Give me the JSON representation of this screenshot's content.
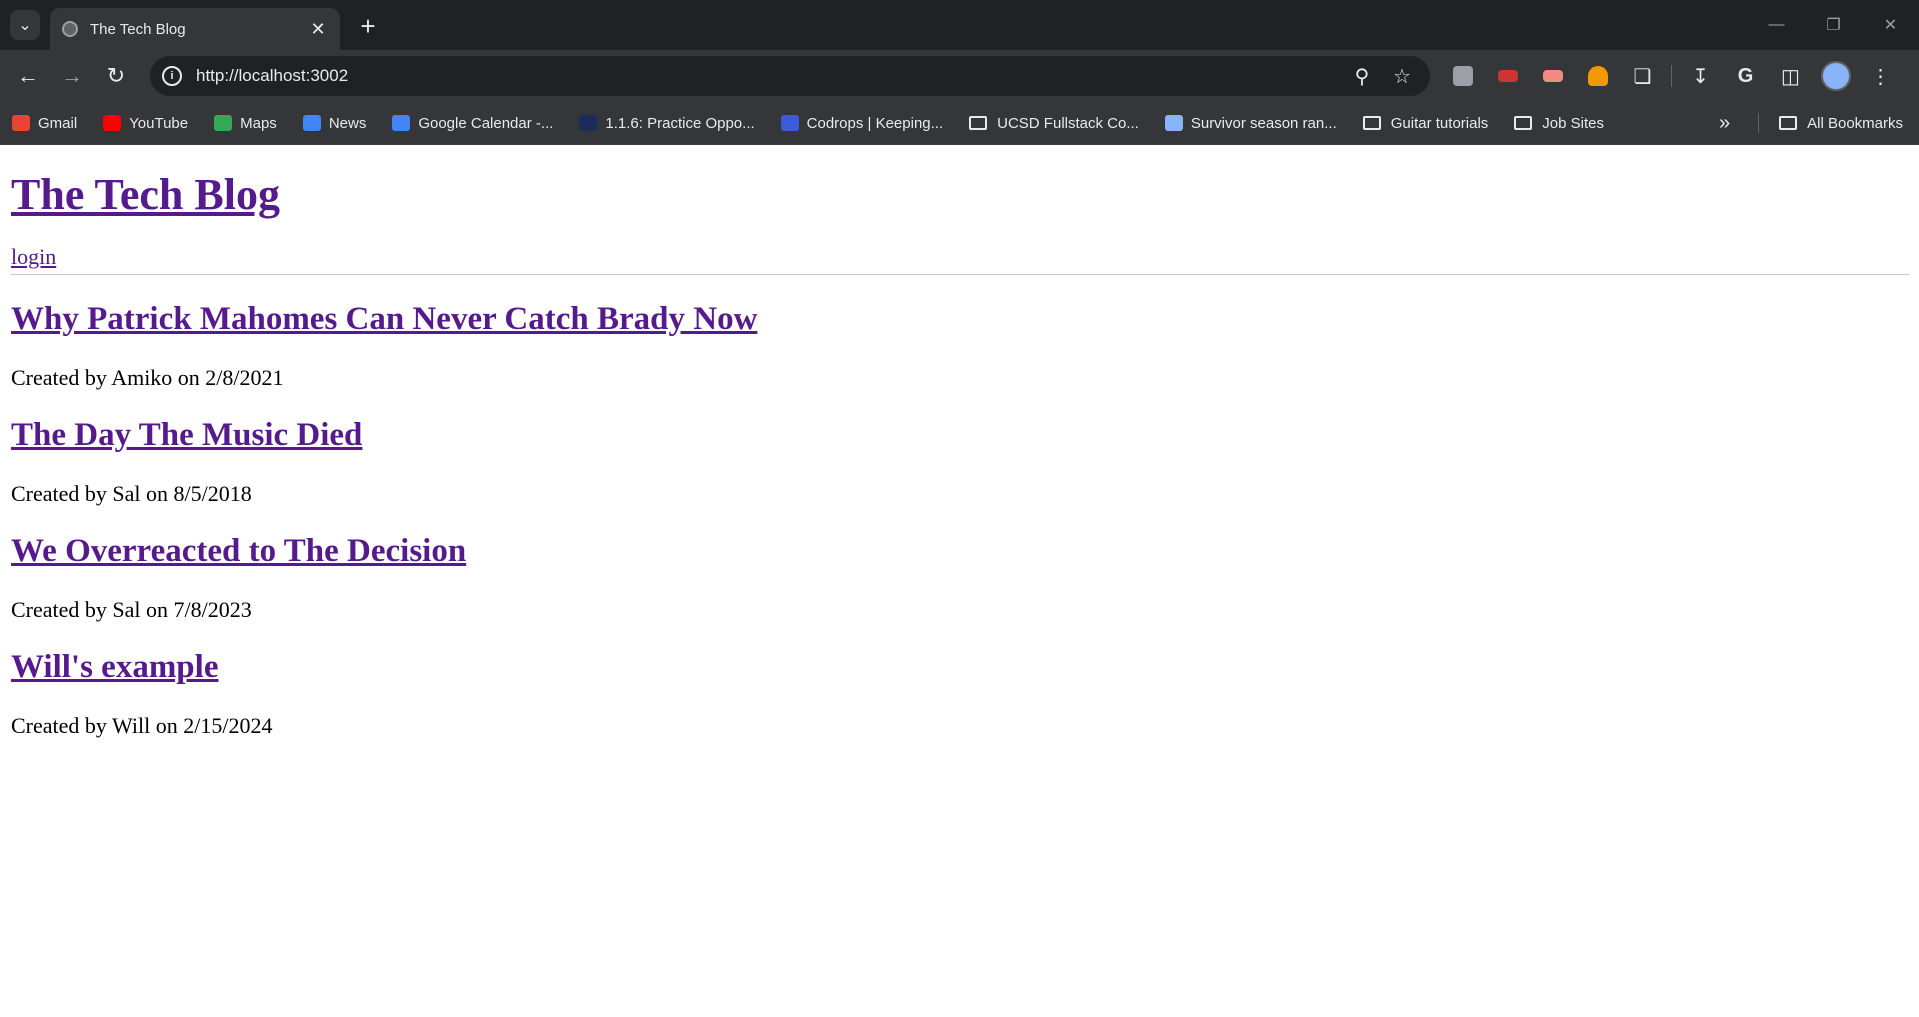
{
  "browser": {
    "tab_title": "The Tech Blog",
    "url": "http://localhost:3002",
    "bookmarks": [
      {
        "label": "Gmail",
        "icon": "gmail-icon",
        "color": "#ea4335"
      },
      {
        "label": "YouTube",
        "icon": "youtube-icon",
        "color": "#ff0000"
      },
      {
        "label": "Maps",
        "icon": "maps-icon",
        "color": "#34a853"
      },
      {
        "label": "News",
        "icon": "news-icon",
        "color": "#4285f4"
      },
      {
        "label": "Google Calendar -...",
        "icon": "calendar-icon",
        "color": "#4285f4"
      },
      {
        "label": "1.1.6: Practice Oppo...",
        "icon": "course-icon",
        "color": "#1a2b5c"
      },
      {
        "label": "Codrops | Keeping...",
        "icon": "codrops-icon",
        "color": "#3b5bdb"
      },
      {
        "label": "UCSD Fullstack Co...",
        "icon": "folder-icon",
        "color": ""
      },
      {
        "label": "Survivor season ran...",
        "icon": "sheet-grid-icon",
        "color": "#8ab4f8"
      },
      {
        "label": "Guitar tutorials",
        "icon": "folder-icon",
        "color": ""
      },
      {
        "label": "Job Sites",
        "icon": "folder-icon",
        "color": ""
      }
    ],
    "all_bookmarks": "All Bookmarks"
  },
  "site": {
    "title": "The Tech Blog",
    "login": "login"
  },
  "posts": [
    {
      "title": "Why Patrick Mahomes Can Never Catch Brady Now",
      "meta": "Created by Amiko on 2/8/2021"
    },
    {
      "title": "The Day The Music Died",
      "meta": "Created by Sal on 8/5/2018"
    },
    {
      "title": "We Overreacted to The Decision",
      "meta": "Created by Sal on 7/8/2023"
    },
    {
      "title": "Will's example",
      "meta": "Created by Will on 2/15/2024"
    }
  ]
}
